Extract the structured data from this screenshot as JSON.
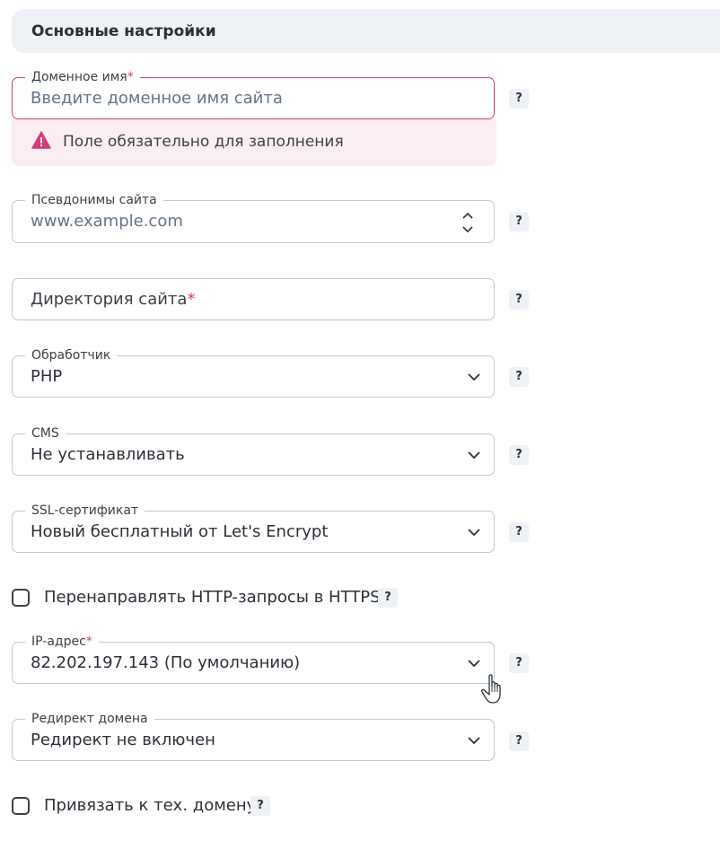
{
  "section": {
    "title": "Основные настройки"
  },
  "help_label": "?",
  "domain": {
    "label": "Доменное имя",
    "required_mark": "*",
    "placeholder": "Введите доменное имя сайта",
    "error": "Поле обязательно для заполнения"
  },
  "aliases": {
    "label": "Псевдонимы сайта",
    "placeholder": "www.example.com"
  },
  "directory": {
    "label": "Директория сайта",
    "required_mark": "*"
  },
  "handler": {
    "label": "Обработчик",
    "value": "PHP"
  },
  "cms": {
    "label": "CMS",
    "value": "Не устанавливать"
  },
  "ssl": {
    "label": "SSL-сертификат",
    "value": "Новый бесплатный от Let's Encrypt"
  },
  "https_redirect": {
    "label": "Перенаправлять HTTP-запросы в HTTPS",
    "checked": false
  },
  "ip": {
    "label": "IP-адрес",
    "required_mark": "*",
    "value": "82.202.197.143 (По умолчанию)"
  },
  "domain_redirect": {
    "label": "Редирект домена",
    "value": "Редирект не включен"
  },
  "tech_domain": {
    "label": "Привязать к тех. домену",
    "checked": false
  },
  "colors": {
    "accent_error": "#d23b7c",
    "border": "#b9ccd7",
    "panel": "#eef2f6"
  }
}
